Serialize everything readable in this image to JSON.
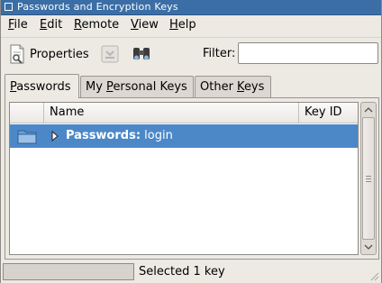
{
  "window": {
    "title": "Passwords and Encryption Keys"
  },
  "menubar": {
    "items": [
      {
        "mnemonic": "F",
        "rest": "ile"
      },
      {
        "mnemonic": "E",
        "rest": "dit"
      },
      {
        "mnemonic": "R",
        "rest": "emote"
      },
      {
        "mnemonic": "V",
        "rest": "iew"
      },
      {
        "mnemonic": "H",
        "rest": "elp"
      }
    ]
  },
  "toolbar": {
    "properties_label": "Properties",
    "properties_icon": "document-properties-icon",
    "export_icon": "export-key-icon",
    "find_icon": "binoculars-icon",
    "filter_label": "Filter:",
    "filter_value": ""
  },
  "tabs": [
    {
      "pre": "",
      "mnemonic": "P",
      "post": "asswords",
      "active": true
    },
    {
      "pre": "My ",
      "mnemonic": "P",
      "post": "ersonal Keys",
      "active": false
    },
    {
      "pre": "Other ",
      "mnemonic": "K",
      "post": "eys",
      "active": false
    }
  ],
  "table": {
    "columns": [
      "Name",
      "Key ID"
    ],
    "rows": [
      {
        "bold": "Passwords:",
        "text": " login",
        "key_id": "",
        "icon": "folder-icon",
        "selected": true
      }
    ]
  },
  "status": {
    "text": "Selected 1 key"
  },
  "colors": {
    "titlebar": "#3b6ea6",
    "selection": "#4c88c8",
    "window_bg": "#ede9e3"
  }
}
